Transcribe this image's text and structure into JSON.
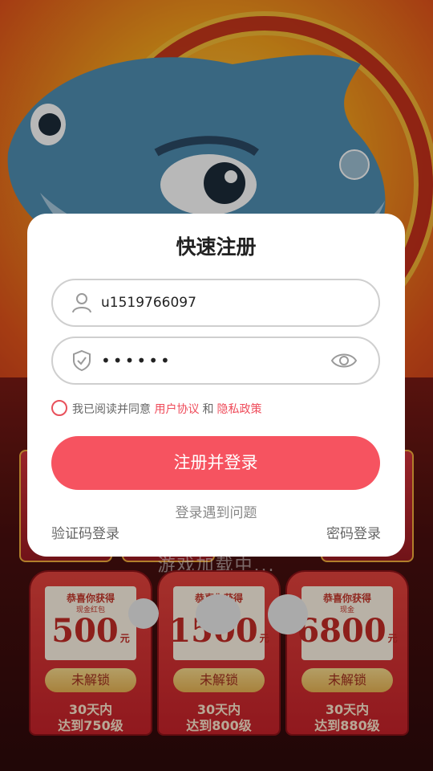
{
  "modal": {
    "title": "快速注册",
    "username": {
      "value": "u1519766097",
      "icon": "user-icon"
    },
    "password": {
      "value": "••••••",
      "icon": "shield-icon",
      "toggle_icon": "eye-icon"
    },
    "agreement": {
      "prefix": "我已阅读并同意",
      "user_agreement": "用户协议",
      "and": "和",
      "privacy_policy": "隐私政策",
      "checked": false
    },
    "submit_label": "注册并登录",
    "help_link": "登录遇到问题",
    "sms_login": "验证码登录",
    "password_login": "密码登录"
  },
  "background": {
    "loading_text": "游戏加载中...",
    "rewards": [
      {
        "title": "恭喜你获得",
        "subtitle": "现金红包",
        "amount": "500",
        "unit": "元",
        "lock": "未解锁",
        "cond1": "30天内",
        "cond2": "达到750级"
      },
      {
        "title": "恭喜你获得",
        "subtitle": "",
        "amount": "1500",
        "unit": "元",
        "lock": "未解锁",
        "cond1": "30天内",
        "cond2": "达到800级"
      },
      {
        "title": "恭喜你获得",
        "subtitle": "现金",
        "amount": "6800",
        "unit": "元",
        "lock": "未解锁",
        "cond1": "30天内",
        "cond2": "达到880级"
      }
    ]
  },
  "colors": {
    "accent": "#f65360",
    "link": "#ef4b5a",
    "modal_bg": "#ffffff"
  }
}
